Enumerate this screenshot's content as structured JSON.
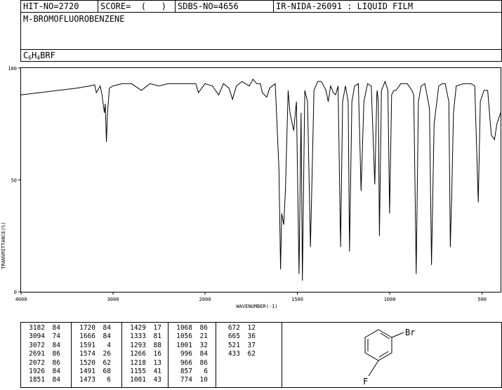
{
  "header": {
    "hit_no": "HIT-NO=2720",
    "score": "SCORE=  (   )",
    "sdbs_no": "SDBS-NO=4656",
    "ir_info": "IR-NIDA-26091 : LIQUID FILM"
  },
  "compound": {
    "name": "M-BROMOFLUOROBENZENE",
    "formula_parts": [
      "C",
      "6",
      "H",
      "4",
      "BRF"
    ]
  },
  "chart_data": {
    "type": "line",
    "title": "",
    "xlabel": "WAVENUMBER(-1)",
    "ylabel": "TRANSMITTANCE(%)",
    "xlim": [
      4000,
      400
    ],
    "ylim": [
      0,
      100
    ],
    "x_ticks": [
      4000,
      3000,
      2000,
      1500,
      1000,
      500
    ],
    "y_ticks": [
      0,
      50,
      100
    ],
    "x_tick_labels": [
      "4000",
      "3000",
      "2000",
      "1500",
      "1000",
      "500"
    ],
    "y_tick_labels": [
      "0",
      "50",
      "100"
    ],
    "grid": false,
    "color": "#000000",
    "series": [
      {
        "x": [
          4000,
          3800,
          3600,
          3400,
          3250,
          3200,
          3182,
          3140,
          3120,
          3094,
          3085,
          3072,
          3060,
          3040,
          3000,
          2900,
          2800,
          2691,
          2600,
          2500,
          2400,
          2300,
          2200,
          2100,
          2072,
          2000,
          1960,
          1926,
          1900,
          1870,
          1851,
          1830,
          1800,
          1760,
          1740,
          1720,
          1700,
          1690,
          1666,
          1650,
          1620,
          1600,
          1591,
          1585,
          1574,
          1565,
          1550,
          1540,
          1520,
          1505,
          1491,
          1480,
          1473,
          1460,
          1445,
          1429,
          1410,
          1390,
          1370,
          1345,
          1333,
          1320,
          1305,
          1293,
          1280,
          1266,
          1255,
          1240,
          1225,
          1218,
          1205,
          1190,
          1170,
          1155,
          1140,
          1120,
          1100,
          1081,
          1070,
          1068,
          1062,
          1056,
          1045,
          1025,
          1010,
          1001,
          990,
          978,
          966,
          940,
          905,
          880,
          870,
          857,
          845,
          830,
          810,
          785,
          774,
          760,
          735,
          715,
          700,
          680,
          672,
          665,
          655,
          640,
          600,
          560,
          540,
          521,
          510,
          490,
          470,
          450,
          433,
          420,
          400
        ],
        "y": [
          88,
          89,
          90,
          91,
          92,
          92.5,
          89,
          92,
          88,
          80,
          84,
          67,
          80,
          91,
          92,
          93,
          93,
          90,
          93,
          92,
          93,
          93,
          93,
          93,
          89,
          93,
          92,
          88,
          93,
          91,
          86,
          92,
          94,
          92,
          95,
          93,
          93,
          89,
          87,
          91,
          93,
          55,
          10,
          35,
          30,
          45,
          90,
          80,
          72,
          85,
          8,
          80,
          5,
          90,
          85,
          20,
          90,
          94,
          94,
          90,
          85,
          92,
          89,
          88,
          92,
          20,
          85,
          92,
          85,
          18,
          85,
          92,
          93,
          45,
          85,
          93,
          92,
          48,
          88,
          90,
          85,
          25,
          90,
          94,
          90,
          35,
          88,
          90,
          90,
          93,
          93,
          90,
          88,
          8,
          85,
          92,
          93,
          82,
          12,
          75,
          92,
          93,
          93,
          85,
          20,
          42,
          80,
          92,
          93,
          93,
          92,
          40,
          85,
          90,
          90,
          70,
          68,
          75,
          80
        ]
      }
    ]
  },
  "peak_table": {
    "columns": [
      [
        [
          "3182",
          "84"
        ],
        [
          "3094",
          "74"
        ],
        [
          "3072",
          "84"
        ],
        [
          "2691",
          "86"
        ],
        [
          "2072",
          "86"
        ],
        [
          "1926",
          "84"
        ],
        [
          "1851",
          "84"
        ]
      ],
      [
        [
          "1720",
          "84"
        ],
        [
          "1666",
          "84"
        ],
        [
          "1591",
          "4"
        ],
        [
          "1574",
          "26"
        ],
        [
          "1520",
          "62"
        ],
        [
          "1491",
          "68"
        ],
        [
          "1473",
          "6"
        ]
      ],
      [
        [
          "1429",
          "17"
        ],
        [
          "1333",
          "81"
        ],
        [
          "1293",
          "88"
        ],
        [
          "1266",
          "16"
        ],
        [
          "1218",
          "13"
        ],
        [
          "1155",
          "41"
        ],
        [
          "1081",
          "43"
        ]
      ],
      [
        [
          "1068",
          "86"
        ],
        [
          "1056",
          "21"
        ],
        [
          "1001",
          "32"
        ],
        [
          "996",
          "84"
        ],
        [
          "966",
          "86"
        ],
        [
          "857",
          "6"
        ],
        [
          "774",
          "10"
        ]
      ],
      [
        [
          "672",
          "12"
        ],
        [
          "665",
          "36"
        ],
        [
          "521",
          "37"
        ],
        [
          "433",
          "62"
        ]
      ]
    ]
  },
  "structure": {
    "label_br": "Br",
    "label_f": "F"
  }
}
